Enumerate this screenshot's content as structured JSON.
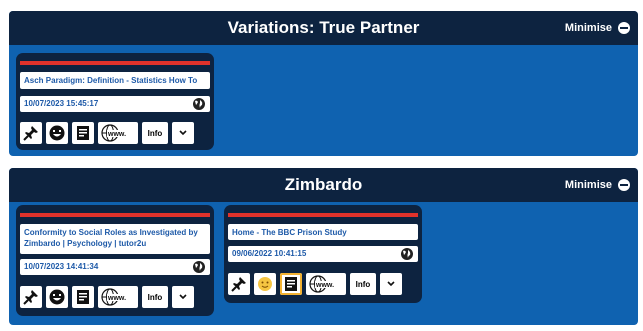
{
  "sections": [
    {
      "title": "Variations: True Partner",
      "minimise_label": "Minimise",
      "cards": [
        {
          "link": "Asch Paradigm: Definition - Statistics How To",
          "datetime": "10/07/2023 15:45:17",
          "info_label": "Info"
        }
      ]
    },
    {
      "title": "Zimbardo",
      "minimise_label": "Minimise",
      "cards": [
        {
          "link": "Conformity to Social Roles as Investigated by Zimbardo | Psychology | tutor2u",
          "datetime": "10/07/2023 14:41:34",
          "info_label": "Info"
        },
        {
          "link": "Home - The BBC Prison Study",
          "datetime": "09/06/2022 10:41:15",
          "info_label": "Info"
        }
      ]
    }
  ],
  "colors": {
    "panel_bg": "#0f62b0",
    "header_bg": "#0d2340",
    "accent_red": "#e0322b",
    "link_blue": "#1e5aa8",
    "selected_outline": "#f2b233"
  },
  "icons": [
    "pin-icon",
    "smiley-icon",
    "notes-icon",
    "www-globe-icon",
    "globe-icon",
    "minus-circle-icon",
    "chevron-down-icon"
  ]
}
